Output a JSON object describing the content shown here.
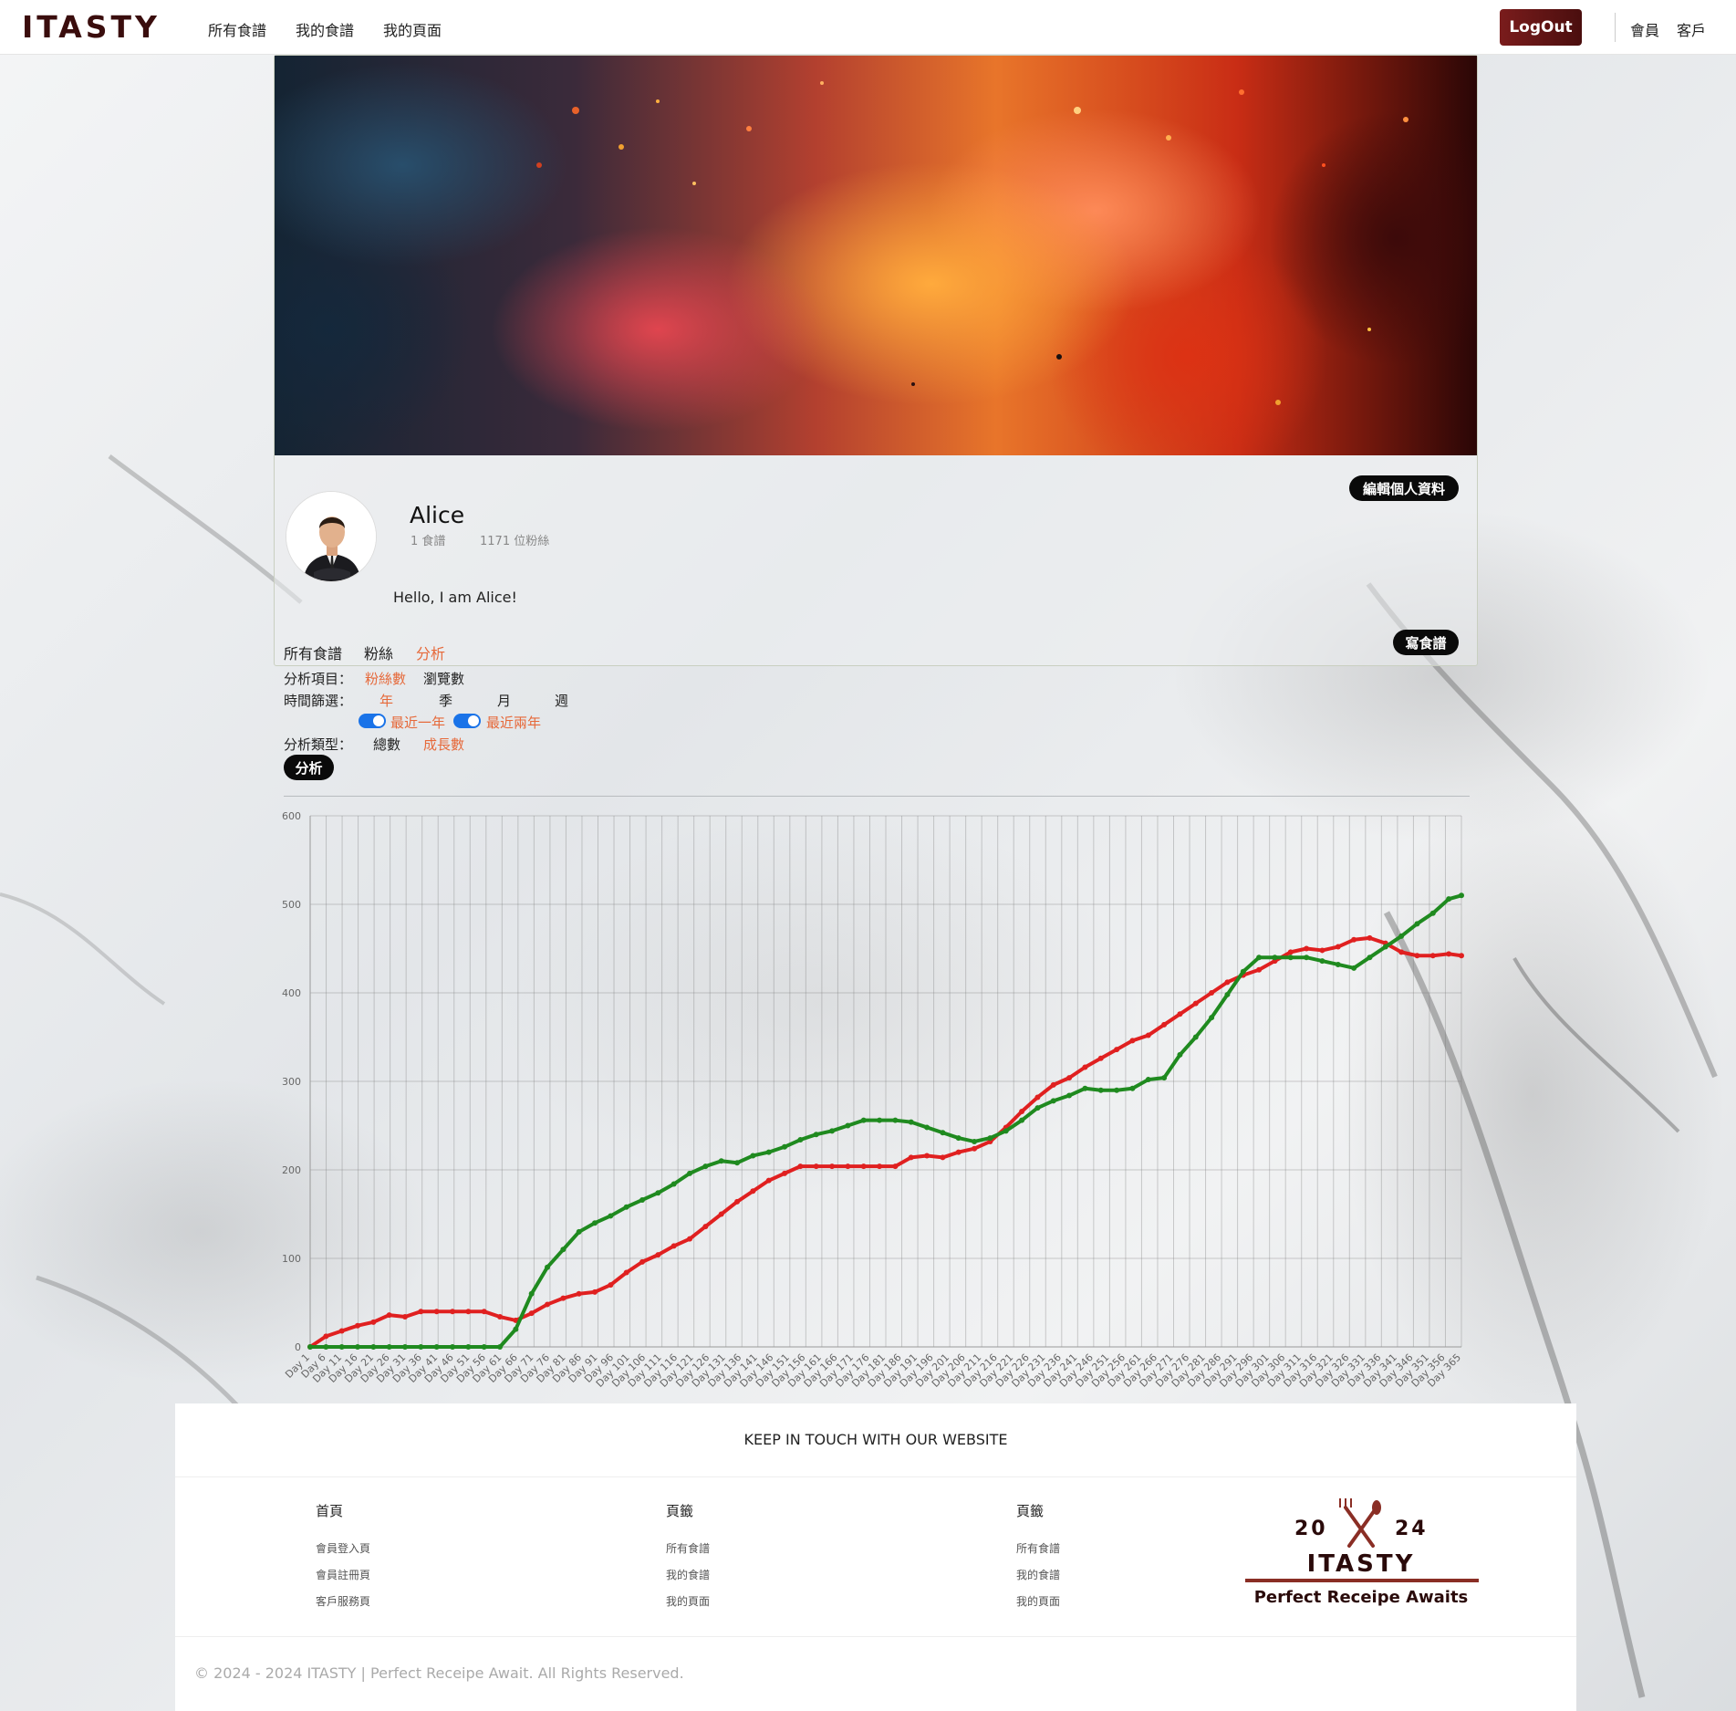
{
  "nav": {
    "brand": "ITASTY",
    "links": [
      "所有食譜",
      "我的食譜",
      "我的頁面"
    ],
    "logout": "LogOut",
    "right_links": [
      "會員",
      "客戶"
    ]
  },
  "profile": {
    "name": "Alice",
    "recipes_count": "1 食譜",
    "followers_count": "1171 位粉絲",
    "bio": "Hello, I am Alice!",
    "edit_button": "編輯個人資料",
    "write_button": "寫食譜",
    "tabs": [
      "所有食譜",
      "粉絲",
      "分析"
    ],
    "active_tab": "分析"
  },
  "analysis": {
    "item_label": "分析項目：",
    "items": [
      "粉絲數",
      "瀏覽數"
    ],
    "active_item": "粉絲數",
    "time_label": "時間篩選：",
    "times": [
      "年",
      "季",
      "月",
      "週"
    ],
    "active_time": "年",
    "toggles": [
      {
        "label": "最近一年",
        "on": true
      },
      {
        "label": "最近兩年",
        "on": true
      }
    ],
    "type_label": "分析類型：",
    "types": [
      "總數",
      "成長數"
    ],
    "active_type": "成長數",
    "analyze_button": "分析"
  },
  "chart_data": {
    "type": "line",
    "ylim": [
      0,
      600
    ],
    "y_ticks": [
      0,
      100,
      200,
      300,
      400,
      500,
      600
    ],
    "x_tick_labels": [
      "Day 1",
      "Day 6",
      "Day 11",
      "Day 16",
      "Day 21",
      "Day 26",
      "Day 31",
      "Day 36",
      "Day 41",
      "Day 46",
      "Day 51",
      "Day 56",
      "Day 61",
      "Day 66",
      "Day 71",
      "Day 76",
      "Day 81",
      "Day 86",
      "Day 91",
      "Day 96",
      "Day 101",
      "Day 106",
      "Day 111",
      "Day 116",
      "Day 121",
      "Day 126",
      "Day 131",
      "Day 136",
      "Day 141",
      "Day 146",
      "Day 151",
      "Day 156",
      "Day 161",
      "Day 166",
      "Day 171",
      "Day 176",
      "Day 181",
      "Day 186",
      "Day 191",
      "Day 196",
      "Day 201",
      "Day 206",
      "Day 211",
      "Day 216",
      "Day 221",
      "Day 226",
      "Day 231",
      "Day 236",
      "Day 241",
      "Day 246",
      "Day 251",
      "Day 256",
      "Day 261",
      "Day 266",
      "Day 271",
      "Day 276",
      "Day 281",
      "Day 286",
      "Day 291",
      "Day 296",
      "Day 301",
      "Day 306",
      "Day 311",
      "Day 316",
      "Day 321",
      "Day 326",
      "Day 331",
      "Day 336",
      "Day 341",
      "Day 346",
      "Day 351",
      "Day 356",
      "Day 365"
    ],
    "grid": true,
    "series": [
      {
        "color": "#e02020",
        "x": [
          1,
          6,
          11,
          16,
          21,
          26,
          31,
          36,
          41,
          46,
          51,
          56,
          61,
          66,
          71,
          76,
          81,
          86,
          91,
          96,
          101,
          106,
          111,
          116,
          121,
          126,
          131,
          136,
          141,
          146,
          151,
          156,
          161,
          166,
          171,
          176,
          181,
          186,
          191,
          196,
          201,
          206,
          211,
          216,
          221,
          226,
          231,
          236,
          241,
          246,
          251,
          256,
          261,
          266,
          271,
          276,
          281,
          286,
          291,
          296,
          301,
          306,
          311,
          316,
          321,
          326,
          331,
          336,
          341,
          346,
          351,
          356,
          361,
          365
        ],
        "values": [
          0,
          12,
          18,
          24,
          28,
          36,
          34,
          40,
          40,
          40,
          40,
          40,
          34,
          30,
          38,
          48,
          55,
          60,
          62,
          70,
          84,
          96,
          104,
          114,
          122,
          136,
          150,
          164,
          176,
          188,
          196,
          204,
          204,
          204,
          204,
          204,
          204,
          204,
          214,
          216,
          214,
          220,
          224,
          232,
          248,
          266,
          282,
          296,
          304,
          316,
          326,
          336,
          346,
          352,
          364,
          376,
          388,
          400,
          412,
          420,
          426,
          436,
          446,
          450,
          448,
          452,
          460,
          462,
          456,
          446,
          442,
          442,
          444,
          442
        ]
      },
      {
        "color": "#1f8a1f",
        "x": [
          1,
          6,
          11,
          16,
          21,
          26,
          31,
          36,
          41,
          46,
          51,
          56,
          61,
          66,
          71,
          76,
          81,
          86,
          91,
          96,
          101,
          106,
          111,
          116,
          121,
          126,
          131,
          136,
          141,
          146,
          151,
          156,
          161,
          166,
          171,
          176,
          181,
          186,
          191,
          196,
          201,
          206,
          211,
          216,
          221,
          226,
          231,
          236,
          241,
          246,
          251,
          256,
          261,
          266,
          271,
          276,
          281,
          286,
          291,
          296,
          301,
          306,
          311,
          316,
          321,
          326,
          331,
          336,
          341,
          346,
          351,
          356,
          361,
          365
        ],
        "values": [
          0,
          0,
          0,
          0,
          0,
          0,
          0,
          0,
          0,
          0,
          0,
          0,
          0,
          20,
          60,
          90,
          110,
          130,
          140,
          148,
          158,
          166,
          174,
          184,
          196,
          204,
          210,
          208,
          216,
          220,
          226,
          234,
          240,
          244,
          250,
          256,
          256,
          256,
          254,
          248,
          242,
          236,
          232,
          236,
          244,
          256,
          270,
          278,
          284,
          292,
          290,
          290,
          292,
          302,
          304,
          330,
          350,
          372,
          398,
          424,
          440,
          440,
          440,
          440,
          436,
          432,
          428,
          440,
          452,
          464,
          478,
          490,
          506,
          510
        ]
      }
    ]
  },
  "footer": {
    "title": "KEEP IN TOUCH WITH OUR WEBSITE",
    "columns": [
      {
        "heading": "首頁",
        "links": [
          "會員登入頁",
          "會員註冊頁",
          "客戶服務頁"
        ]
      },
      {
        "heading": "頁籤",
        "links": [
          "所有食譜",
          "我的食譜",
          "我的頁面"
        ]
      },
      {
        "heading": "頁籤",
        "links": [
          "所有食譜",
          "我的食譜",
          "我的頁面"
        ]
      }
    ],
    "logo": {
      "year_left": "20",
      "year_right": "24",
      "brand": "ITASTY",
      "tagline": "Perfect Receipe Awaits"
    },
    "copyright": "© 2024 - 2024 ITASTY | Perfect Receipe Await. All Rights Reserved."
  }
}
